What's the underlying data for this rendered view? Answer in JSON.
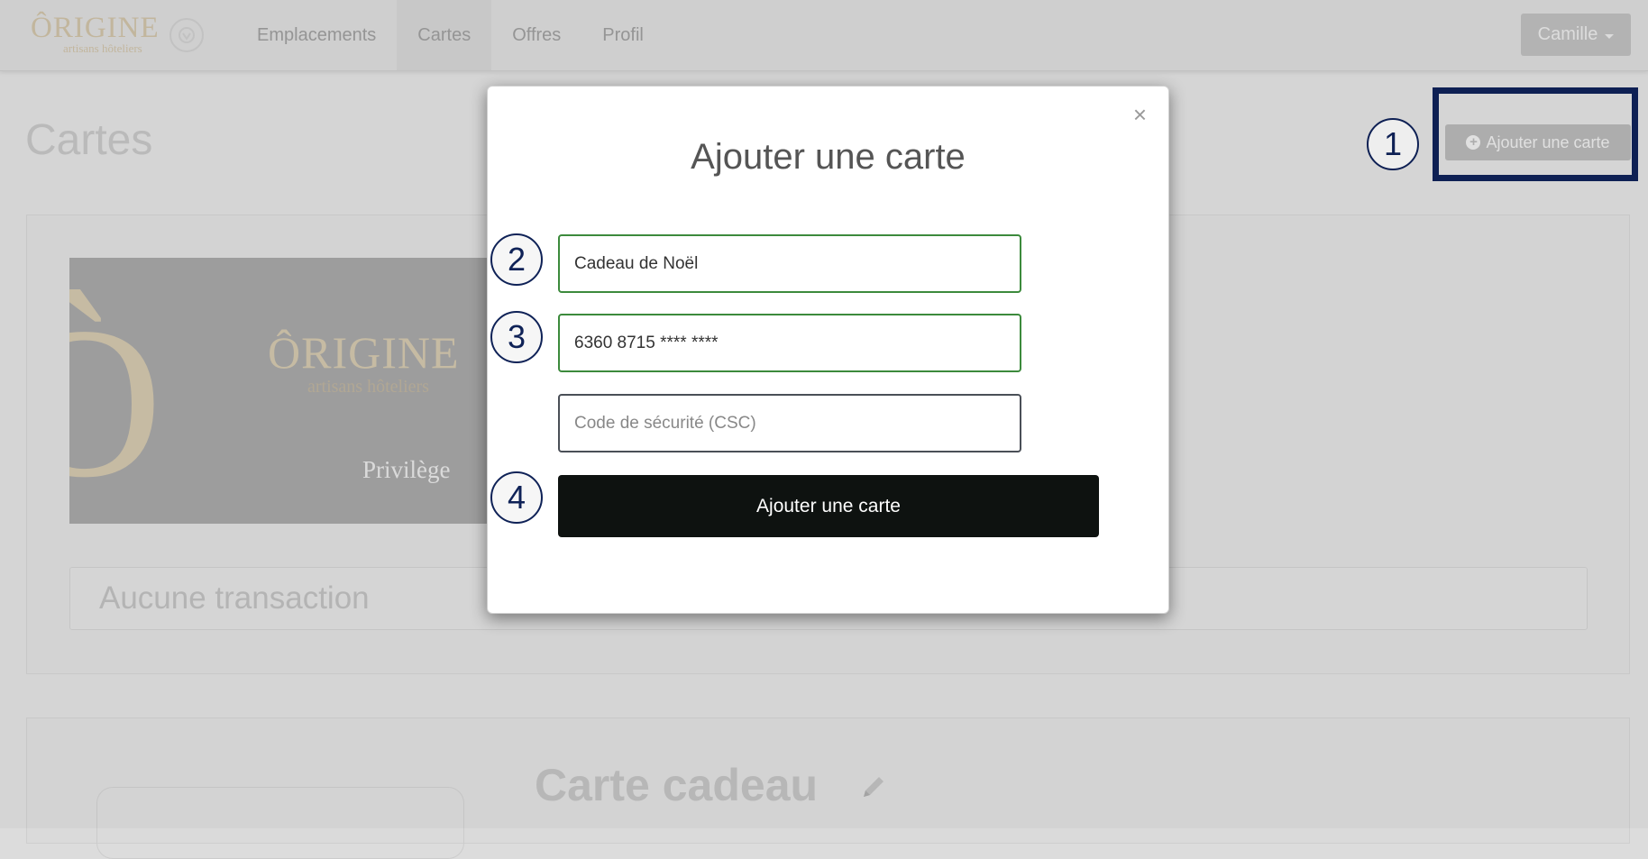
{
  "navbar": {
    "brand": "ÔRIGINE",
    "brand_sub": "artisans hôteliers",
    "links": [
      "Emplacements",
      "Cartes",
      "Offres",
      "Profil"
    ],
    "active_link": "Cartes",
    "user": "Camille"
  },
  "page": {
    "title": "Cartes",
    "add_button": "Ajouter une carte",
    "card_image": {
      "brand": "ÔRIGINE",
      "brand_sub": "artisans hôteliers",
      "tier": "Privilège"
    },
    "transactions_empty": "Aucune transaction",
    "second_card_name": "Carte cadeau"
  },
  "modal": {
    "title": "Ajouter une carte",
    "close": "×",
    "name_value": "Cadeau de Noël",
    "number_value": "6360 8715 **** ****",
    "csc_placeholder": "Code de sécurité (CSC)",
    "submit": "Ajouter une carte"
  },
  "callouts": [
    "1",
    "2",
    "3",
    "4"
  ],
  "colors": {
    "callout": "#0f2257",
    "valid_border": "#3c8a3c",
    "submit_bg": "#0e1210"
  }
}
